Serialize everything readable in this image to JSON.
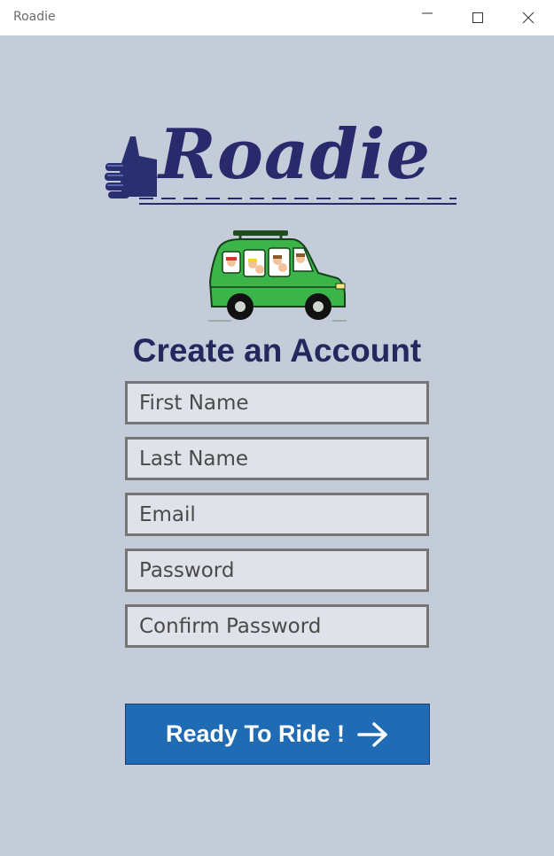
{
  "window": {
    "title": "Roadie",
    "minimize_icon": "minimize-icon",
    "maximize_icon": "maximize-icon",
    "close_icon": "close-icon"
  },
  "logo": {
    "text": "Roadie",
    "icon": "thumbs-up-icon"
  },
  "illustration": {
    "icon": "green-car-with-passengers"
  },
  "form": {
    "heading": "Create an Account",
    "first_name_placeholder": "First Name",
    "last_name_placeholder": "Last Name",
    "email_placeholder": "Email",
    "password_placeholder": "Password",
    "confirm_password_placeholder": "Confirm Password"
  },
  "submit": {
    "label": "Ready To Ride !",
    "icon": "arrow-right-icon"
  },
  "colors": {
    "background": "#c4cbd9",
    "brand_navy": "#29296b",
    "button_blue": "#1f6cb5",
    "car_green": "#3bb54a"
  }
}
